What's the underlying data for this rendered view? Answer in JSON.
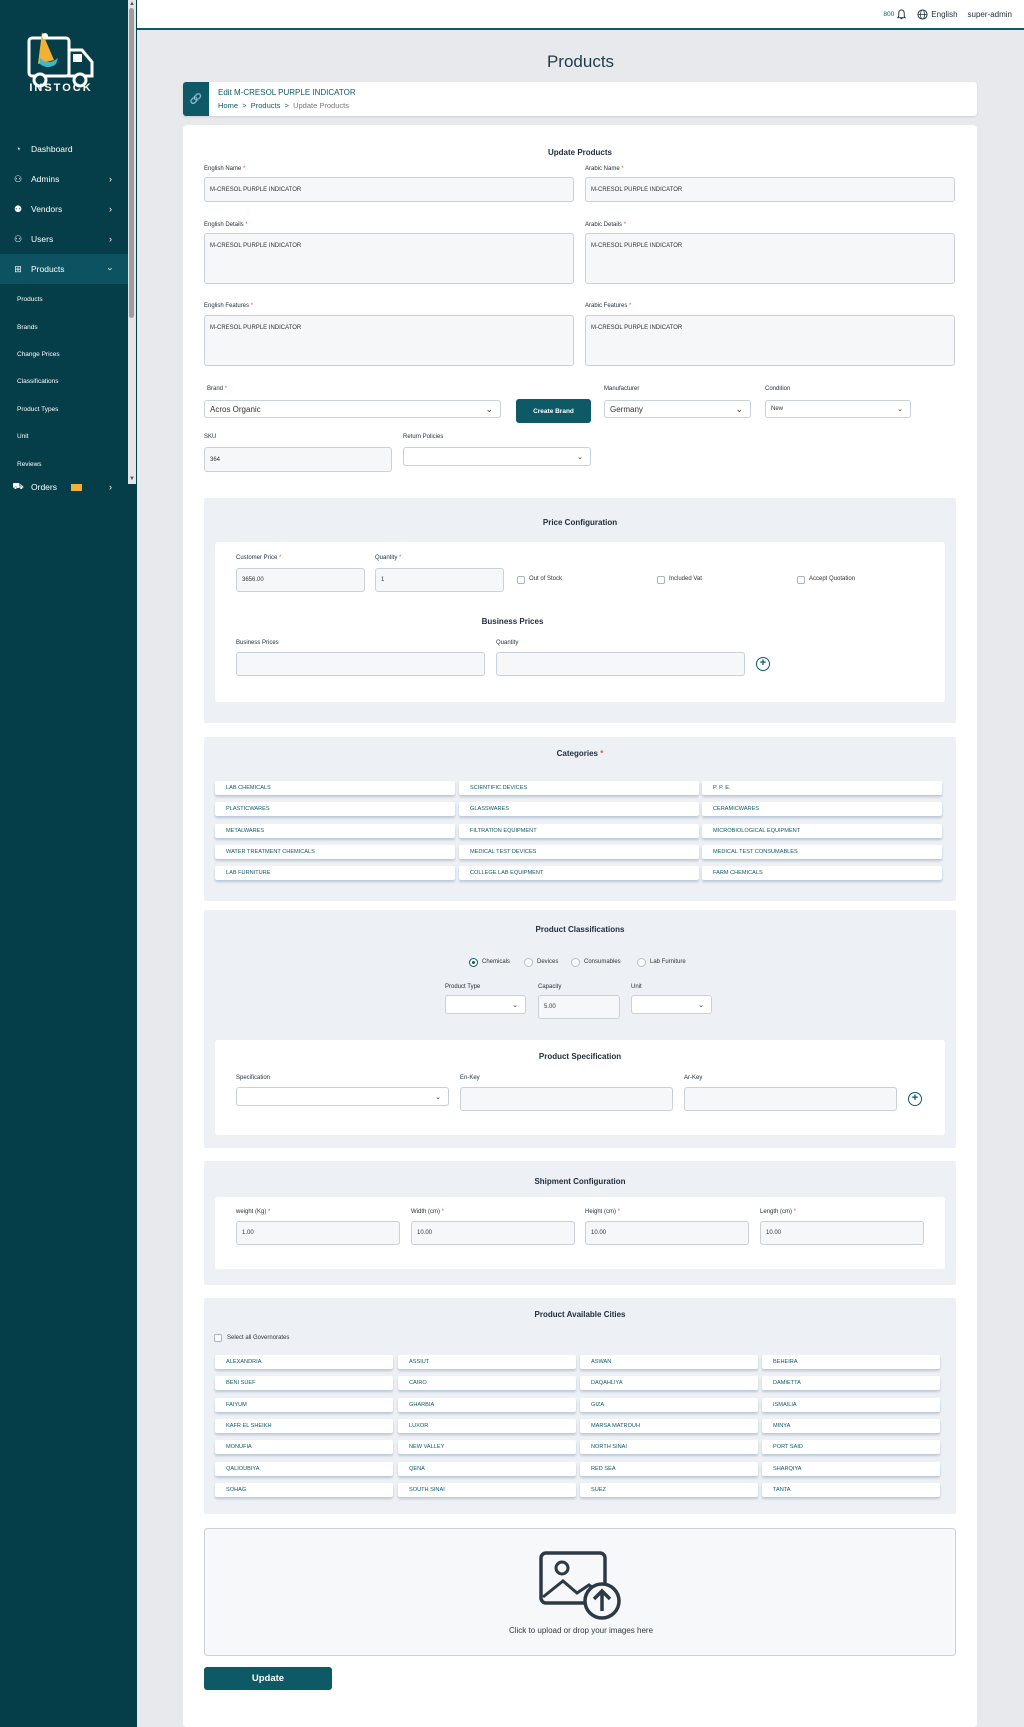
{
  "app": {
    "logo_text": "INSTOCK",
    "brand_color": "#053e48",
    "accent": "#0d5a66"
  },
  "topbar": {
    "notification_count": "800",
    "language": "English",
    "user": "super-admin"
  },
  "sidebar": {
    "items": [
      {
        "label": "Dashboard",
        "icon": "dashboard-icon"
      },
      {
        "label": "Admins",
        "icon": "admin-icon"
      },
      {
        "label": "Vendors",
        "icon": "vendors-icon"
      },
      {
        "label": "Users",
        "icon": "users-icon"
      },
      {
        "label": "Products",
        "icon": "products-icon"
      }
    ],
    "sub_items": [
      "Products",
      "Brands",
      "Change Prices",
      "Classifications",
      "Product Types",
      "Unit",
      "Reviews"
    ],
    "orders_label": "Orders"
  },
  "page": {
    "title": "Products",
    "edit_title": "Edit M-CRESOL PURPLE INDICATOR",
    "breadcrumb": [
      "Home",
      "Products",
      "Update Products"
    ],
    "separator": ">"
  },
  "form": {
    "title": "Update Products",
    "english_name": {
      "label": "English Name",
      "value": "M-CRESOL PURPLE INDICATOR"
    },
    "arabic_name": {
      "label": "Arabic Name",
      "value": "M-CRESOL PURPLE INDICATOR"
    },
    "english_details": {
      "label": "English Details",
      "value": "M-CRESOL PURPLE INDICATOR"
    },
    "arabic_details": {
      "label": "Arabic Details",
      "value": "M-CRESOL PURPLE INDICATOR"
    },
    "english_features": {
      "label": "English Features",
      "value": "M-CRESOL PURPLE INDICATOR"
    },
    "arabic_features": {
      "label": "Arabic Features",
      "value": "M-CRESOL PURPLE INDICATOR"
    },
    "brand": {
      "label": "Brand",
      "value": "Acros Organic"
    },
    "create_brand": "Create Brand",
    "manufacturer": {
      "label": "Manufacturer",
      "value": "Germany"
    },
    "condition": {
      "label": "Condition",
      "value": "New"
    },
    "sku": {
      "label": "SKU",
      "value": "364"
    },
    "return_policies": {
      "label": "Return Policies",
      "value": ""
    },
    "required_mark": "*"
  },
  "price": {
    "title": "Price Configuration",
    "customer_price": {
      "label": "Customer Price",
      "value": "3656.00"
    },
    "quantity": {
      "label": "Quantity",
      "value": "1"
    },
    "out_of_stock": "Out of Stock",
    "included_vat": "Included Vat",
    "accept_quotation": "Accept Quotation",
    "business_title": "Business Prices",
    "business_prices_label": "Business Prices",
    "business_quantity_label": "Quantity"
  },
  "categories": {
    "title": "Categories",
    "items": [
      "LAB CHEMICALS",
      "SCIENTIFIC DEVICES",
      "P. P. E.",
      "PLASTICWARES",
      "GLASSWARES",
      "CERAMICWARES",
      "METALWARES",
      "FILTRATION EQUIPMENT",
      "MICROBIOLOGICAL EQUIPMENT",
      "WATER TREATMENT CHEMICALS",
      "MEDICAL TEST DEVICES",
      "MEDICAL TEST CONSUMABLES",
      "LAB FURNITURE",
      "COLLEGE LAB EQUIPMENT",
      "FARM CHEMICALS"
    ]
  },
  "classifications": {
    "title": "Product Classifications",
    "options": [
      "Chemicals",
      "Devices",
      "Consumables",
      "Lab Furniture"
    ],
    "selected": "Chemicals",
    "product_type_label": "Product Type",
    "capacity": {
      "label": "Capacity",
      "value": "5.00"
    },
    "unit_label": "Unit"
  },
  "specification": {
    "title": "Product Specification",
    "spec_label": "Specification",
    "en_key_label": "En-Key",
    "ar_key_label": "Ar-Key"
  },
  "shipment": {
    "title": "Shipment Configuration",
    "weight": {
      "label": "weight (Kg)",
      "value": "1.00"
    },
    "width": {
      "label": "Width (cm)",
      "value": "10.00"
    },
    "height": {
      "label": "Height (cm)",
      "value": "10.00"
    },
    "length": {
      "label": "Length (cm)",
      "value": "10.00"
    }
  },
  "cities": {
    "title": "Product Available Cities",
    "select_all": "Select all Governorates",
    "items": [
      "ALEXANDRIA",
      "ASSIUT",
      "ASWAN",
      "BEHEIRA",
      "BENI SUEF",
      "CAIRO",
      "DAQAHLIYA",
      "DAMIETTA",
      "FAIYUM",
      "GHARBIA",
      "GIZA",
      "ISMAILIA",
      "KAFR EL SHEIKH",
      "LUXOR",
      "MARSA MATROUH",
      "MINYA",
      "MONUFIA",
      "NEW VALLEY",
      "NORTH SINAI",
      "PORT SAID",
      "QALIOUBIYA",
      "QENA",
      "RED SEA",
      "SHARQIYA",
      "SOHAG",
      "SOUTH SINAI",
      "SUEZ",
      "TANTA"
    ]
  },
  "upload": {
    "text": "Click to upload or drop your images here",
    "icon": "image-upload-icon"
  },
  "update_button": "Update"
}
